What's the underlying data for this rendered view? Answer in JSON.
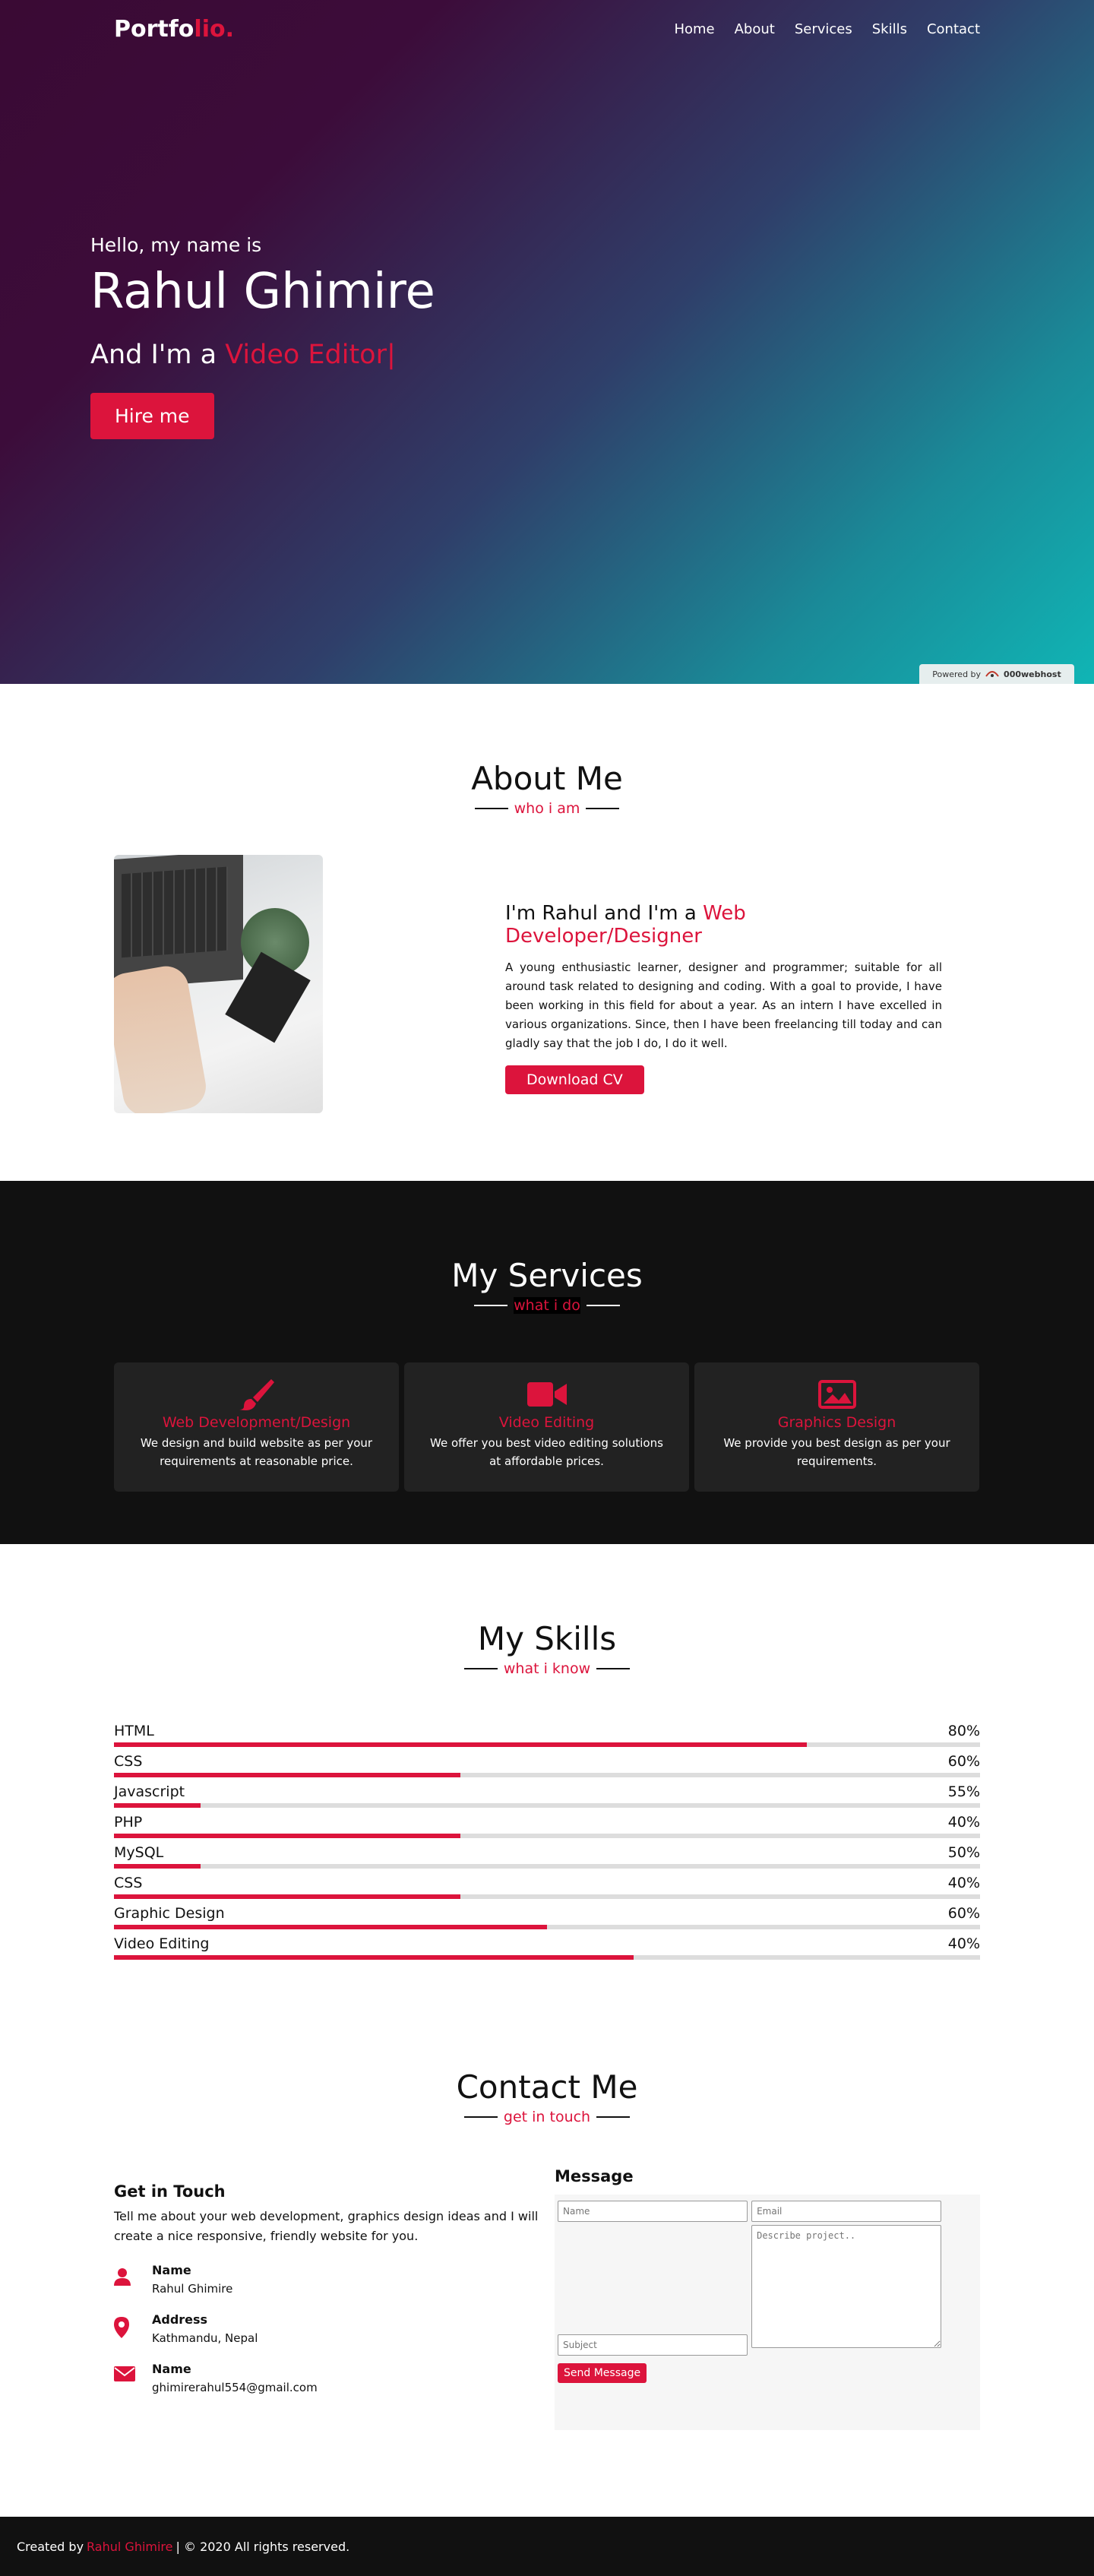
{
  "nav": {
    "logo_main": "Portfo",
    "logo_accent": "lio.",
    "items": [
      "Home",
      "About",
      "Services",
      "Skills",
      "Contact"
    ]
  },
  "hero": {
    "hello": "Hello, my name is",
    "name": "Rahul Ghimire",
    "role_prefix": "And I'm a ",
    "role_typed": "Video Editor|",
    "hire_label": "Hire me",
    "powered_label": "Powered by",
    "powered_brand": "000webhost"
  },
  "about": {
    "title": "About Me",
    "subtitle": "who i am",
    "heading_prefix": "I'm Rahul and I'm a ",
    "heading_highlight": "Web Developer/Designer",
    "body": "A young enthusiastic learner, designer and programmer; suitable for all around task related to designing and coding. With a goal to provide, I have been working in this field for about a year. As an intern I have excelled in various organizations. Since, then I have been freelancing till today and can gladly say that the job I do, I do it well.",
    "cv_label": "Download CV"
  },
  "services": {
    "title": "My Services",
    "subtitle": "what i do",
    "cards": [
      {
        "icon": "paint-brush-icon",
        "title": "Web Development/Design",
        "desc": "We design and build website as per your requirements at reasonable price."
      },
      {
        "icon": "video-camera-icon",
        "title": "Video Editing",
        "desc": "We offer you best video editing solutions at affordable prices."
      },
      {
        "icon": "image-icon",
        "title": "Graphics Design",
        "desc": "We provide you best design as per your requirements."
      }
    ]
  },
  "skills": {
    "title": "My Skills",
    "subtitle": "what i know",
    "items": [
      {
        "name": "HTML",
        "percent": "80%",
        "fill": 80
      },
      {
        "name": "CSS",
        "percent": "60%",
        "fill": 40
      },
      {
        "name": "Javascript",
        "percent": "55%",
        "fill": 10
      },
      {
        "name": "PHP",
        "percent": "40%",
        "fill": 40
      },
      {
        "name": "MySQL",
        "percent": "50%",
        "fill": 10
      },
      {
        "name": "CSS",
        "percent": "40%",
        "fill": 40
      },
      {
        "name": "Graphic Design",
        "percent": "60%",
        "fill": 50
      },
      {
        "name": "Video Editing",
        "percent": "40%",
        "fill": 60
      }
    ]
  },
  "contact": {
    "title": "Contact Me",
    "subtitle": "get in touch",
    "get_in_touch": "Get in Touch",
    "desc": "Tell me about your web development, graphics design ideas and I will create a nice responsive, friendly website for you.",
    "info": [
      {
        "icon": "user-icon",
        "head": "Name",
        "value": "Rahul Ghimire"
      },
      {
        "icon": "map-marker-icon",
        "head": "Address",
        "value": "Kathmandu, Nepal"
      },
      {
        "icon": "envelope-icon",
        "head": "Name",
        "value": "ghimirerahul554@gmail.com"
      }
    ],
    "message_title": "Message",
    "placeholders": {
      "name": "Name",
      "email": "Email",
      "subject": "Subject",
      "project": "Describe project.."
    },
    "send_label": "Send Message"
  },
  "footer": {
    "prefix": "Created by",
    "author": "Rahul Ghimire",
    "suffix": "| © 2020 All rights reserved."
  },
  "colors": {
    "accent": "#dc143c",
    "dark": "#111111"
  }
}
